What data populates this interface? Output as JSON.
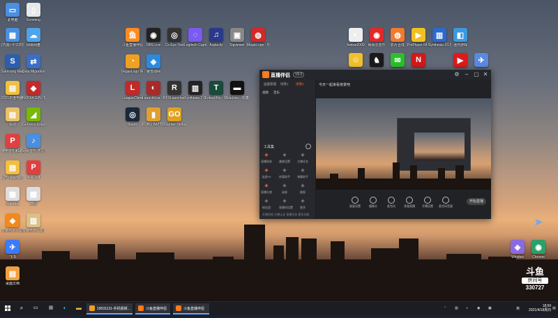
{
  "desktop_icons": [
    {
      "label": "此电脑",
      "color": "#4a8fe0",
      "glyph": "▭"
    },
    {
      "label": "Evoming",
      "color": "#e8e8e8",
      "glyph": "▯"
    },
    {
      "label": "(内置)-中文的应用",
      "color": "#4a8fe0",
      "glyph": "▦"
    },
    {
      "label": "网易网盘",
      "color": "#4fa3e8",
      "glyph": "☁"
    },
    {
      "label": "Samsung Magician",
      "color": "#2a5fae",
      "glyph": "S"
    },
    {
      "label": "Data Migration",
      "color": "#3a6fc8",
      "glyph": "⇄"
    },
    {
      "label": "2021年度电脑使用报告",
      "color": "#f0c040",
      "glyph": "▤"
    },
    {
      "label": "NVIDIA GPU Tweak",
      "color": "#c42a2a",
      "glyph": "◆"
    },
    {
      "label": "赞助",
      "color": "#e8c26a",
      "glyph": "▤"
    },
    {
      "label": "GeForce Experience",
      "color": "#76b900",
      "glyph": "◢"
    },
    {
      "label": "使用音乐和歌曲的提示",
      "color": "#e04040",
      "glyph": "P"
    },
    {
      "label": "网易音乐-不同的音乐",
      "color": "#4a8fe0",
      "glyph": "♪"
    },
    {
      "label": "图形ology轴线",
      "color": "#f0c040",
      "glyph": "▤"
    },
    {
      "label": "手机.pdf",
      "color": "#e04040",
      "glyph": "P"
    },
    {
      "label": "calendar",
      "color": "#dddddd",
      "glyph": "▦"
    },
    {
      "label": "日历",
      "color": "#dddddd",
      "glyph": "▦"
    },
    {
      "label": "安装自定义配置",
      "color": "#f08a20",
      "glyph": "◈"
    },
    {
      "label": "安装自定义配置",
      "color": "#d9c08a",
      "glyph": "▥"
    },
    {
      "label": "飞书",
      "color": "#3a7bff",
      "glyph": "✈"
    },
    {
      "label": "桌面文档",
      "color": "#f0a040",
      "glyph": "▤"
    },
    {
      "label": "斗鱼直播伴侣",
      "color": "#ff8a20",
      "glyph": "鱼"
    },
    {
      "label": "OBS Live",
      "color": "#222222",
      "glyph": "◉"
    },
    {
      "label": "Cx-Eye Test",
      "color": "#333333",
      "glyph": "◎"
    },
    {
      "label": "Logitech Capture",
      "color": "#7a5af0",
      "glyph": "◌"
    },
    {
      "label": "Audacity",
      "color": "#2a3a8a",
      "glyph": "♫"
    },
    {
      "label": "Sigviewer",
      "color": "#888888",
      "glyph": "▣"
    },
    {
      "label": "MagicLogo - 快捷方式",
      "color": "#d02a2a",
      "glyph": "◍"
    },
    {
      "label": "VegasLogo 快捷方式",
      "color": "#f0a020",
      "glyph": "◔"
    },
    {
      "label": "暴雪战网",
      "color": "#2a8ae0",
      "glyph": "◈"
    },
    {
      "label": "LeagueClient",
      "color": "#c02a2a",
      "glyph": "L"
    },
    {
      "label": "LaunchLive - 快捷方式",
      "color": "#aa2a2a",
      "glyph": "◐"
    },
    {
      "label": "RFXLauncher - 快捷方式",
      "color": "#333333",
      "glyph": "R"
    },
    {
      "label": "Synthesia 2 Game - 快捷方式",
      "color": "#222222",
      "glyph": "▥"
    },
    {
      "label": "Fritual Blu - 快捷方式",
      "color": "#1a4a3a",
      "glyph": "T"
    },
    {
      "label": "SiteLine - 快捷方式",
      "color": "#111111",
      "glyph": "▬"
    },
    {
      "label": "Steam",
      "color": "#1b2838",
      "glyph": "◎"
    },
    {
      "label": "PUBG BATTLEGROUNDS",
      "color": "#e0a030",
      "glyph": "▮"
    },
    {
      "label": "Counter-Strike Global Off.",
      "color": "#e0a020",
      "glyph": "GO"
    },
    {
      "label": "foobar2000",
      "color": "#eeeeee",
      "glyph": "◐"
    },
    {
      "label": "网易云音乐",
      "color": "#e02a2a",
      "glyph": "◉"
    },
    {
      "label": "影片合成",
      "color": "#f07a30",
      "glyph": "◍"
    },
    {
      "label": "PotPlayer 64 bit",
      "color": "#f0c020",
      "glyph": "▶"
    },
    {
      "label": "Synthesia 10.1",
      "color": "#2a6ad0",
      "glyph": "▥"
    },
    {
      "label": "迷你游戏",
      "color": "#3a9ae0",
      "glyph": "◧"
    },
    {
      "label": "",
      "color": "#f0c030",
      "glyph": "☺"
    },
    {
      "label": "",
      "color": "#1a1a1a",
      "glyph": "♞"
    },
    {
      "label": "",
      "color": "#2ac02a",
      "glyph": "✉"
    },
    {
      "label": "",
      "color": "#d01a1a",
      "glyph": "N"
    },
    {
      "label": "",
      "color": "#e01a1a",
      "glyph": "▶"
    },
    {
      "label": "",
      "color": "#5a8ae0",
      "glyph": "✈"
    },
    {
      "label": "Window",
      "color": "#8a6ae0",
      "glyph": "◈"
    },
    {
      "label": "Chrome",
      "color": "#2aa06a",
      "glyph": "◉"
    }
  ],
  "app": {
    "title": "直播伴侣",
    "version": "V6.0",
    "tabs": [
      "画面管理",
      "场景1",
      "场景2"
    ],
    "scene_items": [
      "视频",
      "音乐"
    ],
    "stream_title": "今天一起来看夜景吧",
    "tools_label": "工具集",
    "tools": [
      {
        "label": "直播贴纸",
        "color": "#ff6a3a"
      },
      {
        "label": "美颜设置",
        "color": "#888"
      },
      {
        "label": "主播任务",
        "color": "#888"
      },
      {
        "label": "连麦PK",
        "color": "#ff6a3a"
      },
      {
        "label": "房管助手",
        "color": "#888"
      },
      {
        "label": "弹幕助手",
        "color": "#888"
      },
      {
        "label": "直播礼物",
        "color": "#ff6a3a"
      },
      {
        "label": "录屏",
        "color": "#888"
      },
      {
        "label": "截图",
        "color": "#888"
      },
      {
        "label": "粉丝团",
        "color": "#888"
      },
      {
        "label": "直播间设置",
        "color": "#888"
      },
      {
        "label": "更多",
        "color": "#888"
      }
    ],
    "controls": [
      "画面设置",
      "摄像头",
      "麦克风",
      "多路直播",
      "开播设置",
      "麦克风音量"
    ],
    "live_button": "开始直播",
    "bottom_links": "开播须知  主播认证  直播任务  更多功能"
  },
  "taskbar": {
    "tasks": [
      {
        "label": "19031131-手机视频...",
        "color": "#f0a020"
      },
      {
        "label": "斗鱼直播伴侣",
        "color": "#ff7a1a"
      },
      {
        "label": "斗鱼直播伴侣",
        "color": "#ff7a1a"
      }
    ],
    "tray_lang": "英",
    "time": "18:50",
    "date": "2021/4/18周日"
  },
  "watermark": {
    "brand": "斗鱼",
    "room_label": "房间号",
    "room_number": "330727"
  }
}
